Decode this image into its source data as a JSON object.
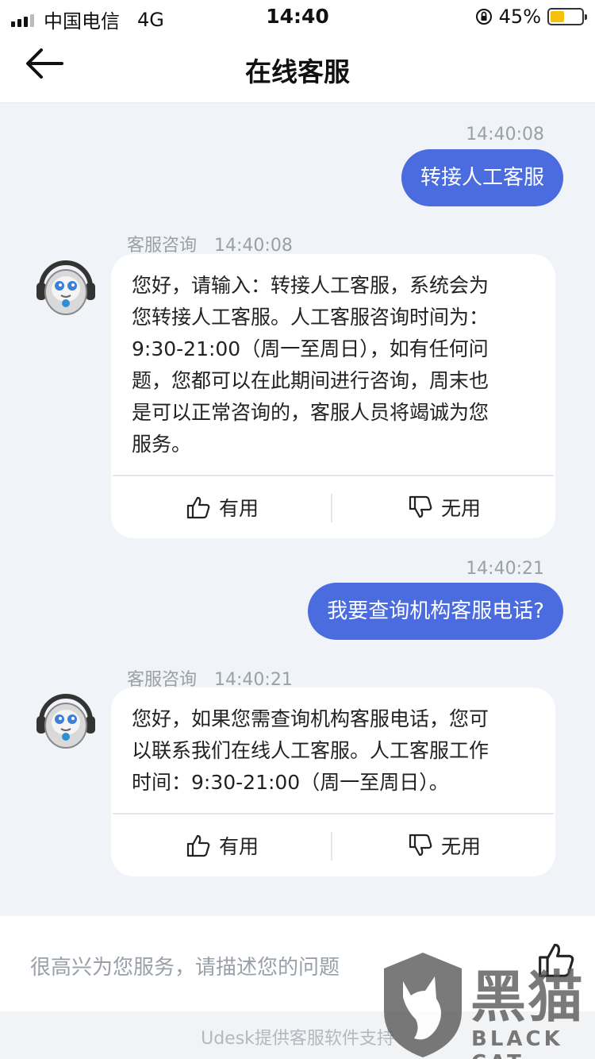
{
  "status_bar": {
    "carrier": "中国电信",
    "network": "4G",
    "time": "14:40",
    "battery_percent": "45%",
    "battery_level": 0.45
  },
  "header": {
    "title": "在线客服"
  },
  "messages": [
    {
      "type": "user",
      "time": "14:40:08",
      "text": "转接人工客服"
    },
    {
      "type": "agent",
      "agent_name": "客服咨询",
      "time": "14:40:08",
      "lines": [
        "您好，请输入：转接人工客服，系统会为",
        "您转接人工客服。人工客服咨询时间为：",
        "9:30-21:00（周一至周日），如有任何问",
        "题，您都可以在此期间进行咨询，周末也",
        "是可以正常咨询的，客服人员将竭诚为您",
        "服务。"
      ],
      "useful_label": "有用",
      "useless_label": "无用"
    },
    {
      "type": "user",
      "time": "14:40:21",
      "text": "我要查询机构客服电话?"
    },
    {
      "type": "agent",
      "agent_name": "客服咨询",
      "time": "14:40:21",
      "lines": [
        "您好，如果您需查询机构客服电话，您可",
        "以联系我们在线人工客服。人工客服工作",
        "时间：9:30-21:00（周一至周日）。"
      ],
      "useful_label": "有用",
      "useless_label": "无用"
    }
  ],
  "input": {
    "placeholder": "很高兴为您服务，请描述您的问题"
  },
  "footer": {
    "text": "Udesk提供客服软件支持"
  },
  "watermark": {
    "zh": "黑猫",
    "en": "BLACK CAT"
  },
  "colors": {
    "accent": "#4a6cdf",
    "background": "#f0f3f8",
    "battery": "#f4c20d"
  }
}
